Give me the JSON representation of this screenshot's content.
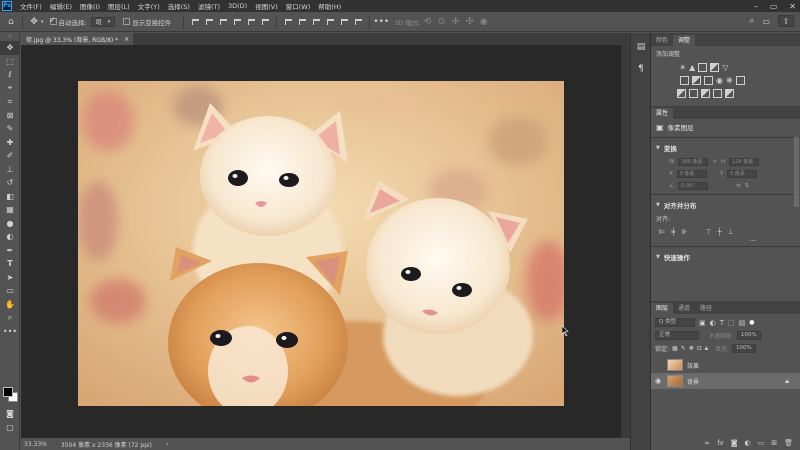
{
  "menubar": {
    "items": [
      "文件(F)",
      "编辑(E)",
      "图像(I)",
      "图层(L)",
      "文字(Y)",
      "选择(S)",
      "滤镜(T)",
      "3D(D)",
      "视图(V)",
      "窗口(W)",
      "帮助(H)"
    ]
  },
  "options": {
    "auto_select_label": "自动选择:",
    "auto_select_value": "组",
    "show_transform_label": "显示变换控件",
    "mode_3d_label": "3D 模式:"
  },
  "document": {
    "tab_title": "荷.jpg @ 33.3% (背景, RGB/8) *",
    "close_glyph": "×"
  },
  "status": {
    "zoom": "33.33%",
    "doc_info": "3504 像素 x 2336 像素 (72 ppi)"
  },
  "panels": {
    "top_tabs": [
      "颜色",
      "调整"
    ],
    "add_adjustment": "添加调整",
    "properties_tab": "属性",
    "pixel_layer": "像素图层",
    "transform_title": "变换",
    "w_label": "W",
    "h_label": "H",
    "x_label": "X",
    "y_label": "Y",
    "w_value": "186 像素",
    "h_value": "124 像素",
    "x_value": "0 像素",
    "y_value": "0 像素",
    "angle_value": "0.00°",
    "align_title": "对齐并分布",
    "align_label": "对齐:",
    "quick_title": "快速操作",
    "layers_tabs": [
      "图层",
      "通道",
      "路径"
    ],
    "kind_label": "Q 类型",
    "blend_mode": "正常",
    "opacity_label": "不透明度:",
    "opacity_value": "100%",
    "lock_label": "锁定:",
    "fill_label": "填充:",
    "fill_value": "100%",
    "layers": [
      {
        "name": "效果",
        "visible": false,
        "selected": false
      },
      {
        "name": "背景",
        "visible": true,
        "selected": true
      }
    ]
  },
  "colors": {
    "foreground": "#000000",
    "background": "#ffffff",
    "accent": "#31a8ff"
  },
  "icons": {
    "home": "home-icon",
    "move": "move-icon",
    "search": "search-icon",
    "share": "share-icon"
  }
}
